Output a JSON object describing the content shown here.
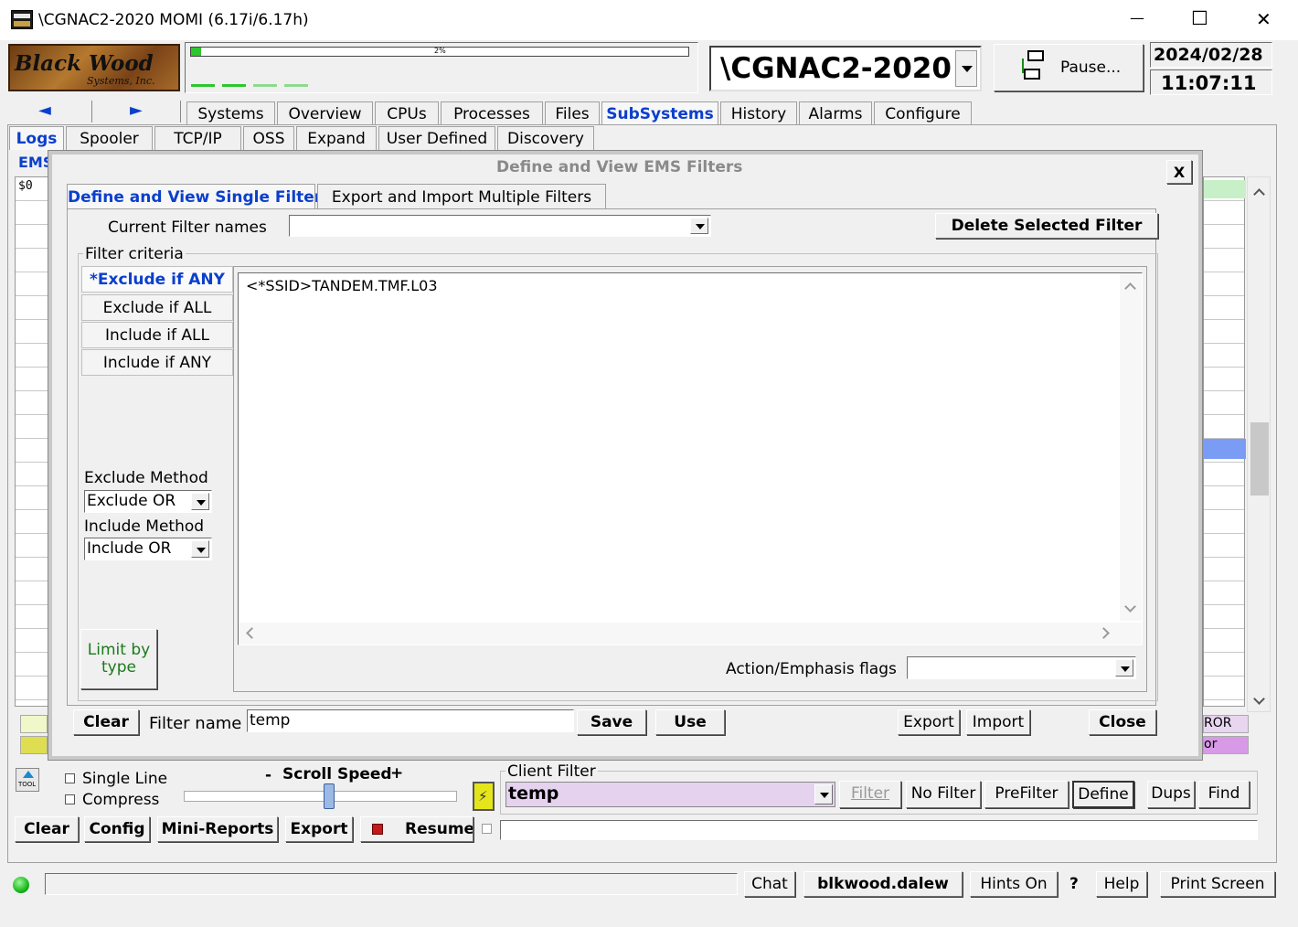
{
  "window": {
    "title": "\\CGNAC2-2020 MOMI (6.17i/6.17h)",
    "minimize": "—",
    "maximize": "☐",
    "close": "✕"
  },
  "logo": {
    "line1": "Black Wood",
    "line2": "Systems, Inc."
  },
  "progress": {
    "label": "2%",
    "value": 0.02
  },
  "system_selector": {
    "value": "\\CGNAC2-2020"
  },
  "pause_button": {
    "label": "Pause..."
  },
  "datetime": {
    "date": "2024/02/28",
    "time": "11:07:11"
  },
  "nav_arrows": {
    "back": "◄",
    "forward": "►"
  },
  "main_tabs": [
    "Systems",
    "Overview",
    "CPUs",
    "Processes",
    "Files",
    "SubSystems",
    "History",
    "Alarms",
    "Configure"
  ],
  "sub_tabs": [
    "Logs",
    "Spooler",
    "TCP/IP",
    "OSS",
    "Expand",
    "User Defined",
    "Discovery"
  ],
  "bg": {
    "ems_label": "EMS",
    "dollar_label": "$0",
    "error_text": "ROR",
    "or_text": "or"
  },
  "dialog": {
    "title": "Define and View EMS Filters",
    "close_x": "X",
    "tabs": [
      "Define and View Single Filter",
      "Export and Import Multiple Filters"
    ],
    "current_filter_label": "Current Filter names",
    "current_filter_value": "",
    "delete_button": "Delete Selected Filter",
    "criteria_label": "Filter criteria",
    "criteria_tabs": [
      "*Exclude if ANY",
      "Exclude if ALL",
      "Include if ALL",
      "Include if ANY"
    ],
    "criteria_text": "<*SSID>TANDEM.TMF.L03",
    "exclude_method_label": "Exclude Method",
    "exclude_method_value": "Exclude OR",
    "include_method_label": "Include Method",
    "include_method_value": "Include OR",
    "limit_button": "Limit by type",
    "action_flags_label": "Action/Emphasis flags",
    "action_flags_value": "",
    "clear_button": "Clear",
    "filter_name_label": "Filter name",
    "filter_name_value": "temp",
    "save_button": "Save",
    "use_button": "Use",
    "export_button": "Export",
    "import_button": "Import",
    "close_button": "Close"
  },
  "controls": {
    "single_line": "Single Line",
    "compress": "Compress",
    "scroll_speed": "Scroll Speed",
    "minus": "-",
    "plus": "+",
    "tool_label": "TOOL",
    "client_filter_label": "Client Filter",
    "client_filter_value": "temp",
    "filter_btn": "Filter",
    "no_filter_btn": "No Filter",
    "prefilter_btn": "PreFilter",
    "define_btn": "Define",
    "dups_btn": "Dups",
    "find_btn": "Find",
    "clear_btn": "Clear",
    "config_btn": "Config",
    "mini_reports_btn": "Mini-Reports",
    "export_btn": "Export",
    "resume_btn": "Resume"
  },
  "status": {
    "chat": "Chat",
    "user": "blkwood.dalew",
    "hints": "Hints On",
    "question": "?",
    "help": "Help",
    "print_screen": "Print Screen"
  },
  "colors": {
    "accent_blue": "#0b3fcc",
    "green_text": "#1a7a1a",
    "client_filter_bg": "#e5d2ef",
    "status_green": "#22c022"
  }
}
